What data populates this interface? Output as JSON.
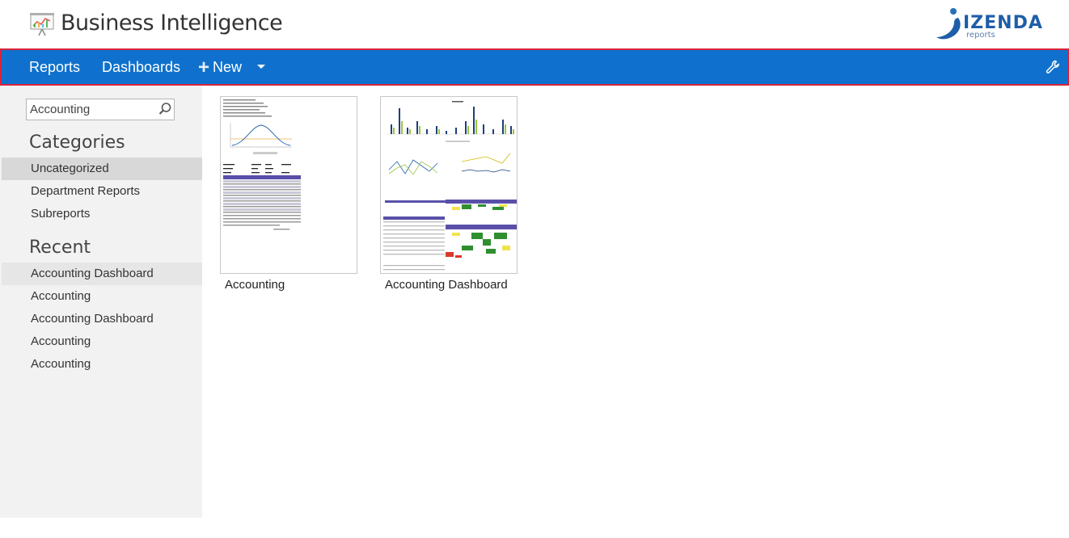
{
  "header": {
    "title": "Business Intelligence",
    "app_icon": "presentation-chart-icon",
    "logo": {
      "word": "IZENDA",
      "sub": "reports"
    }
  },
  "nav": {
    "items": [
      {
        "label": "Reports"
      },
      {
        "label": "Dashboards"
      }
    ],
    "new_label": "New",
    "new_icon": "plus-icon",
    "dropdown_icon": "caret-down-icon",
    "settings_icon": "wrench-icon",
    "accent_color": "#0f71cd",
    "highlight_border_color": "#d9243a"
  },
  "sidebar": {
    "search": {
      "value": "Accounting",
      "icon": "search-icon"
    },
    "categories_title": "Categories",
    "categories": [
      {
        "label": "Uncategorized",
        "selected": true
      },
      {
        "label": "Department Reports"
      },
      {
        "label": "Subreports"
      }
    ],
    "recent_title": "Recent",
    "recent": [
      {
        "label": "Accounting Dashboard"
      },
      {
        "label": "Accounting"
      },
      {
        "label": "Accounting Dashboard"
      },
      {
        "label": "Accounting"
      },
      {
        "label": "Accounting"
      }
    ]
  },
  "main": {
    "tiles": [
      {
        "label": "Accounting"
      },
      {
        "label": "Accounting Dashboard"
      }
    ]
  }
}
